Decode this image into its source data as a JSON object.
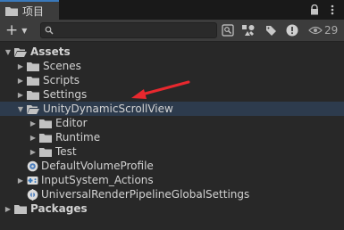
{
  "tab": {
    "label": "项目",
    "icon": "folder-icon"
  },
  "window_controls": {
    "lock_icon": "lock-icon",
    "menu_icon": "kebab-menu-icon"
  },
  "toolbar": {
    "add_label": "+",
    "search": {
      "value": "",
      "placeholder": ""
    },
    "hidden_count": "29"
  },
  "tree": [
    {
      "id": "assets",
      "label": "Assets",
      "bold": true,
      "expanded": true,
      "depth": 0,
      "icon": "folder-open-icon"
    },
    {
      "id": "scenes",
      "label": "Scenes",
      "depth": 1,
      "icon": "folder-icon"
    },
    {
      "id": "scripts",
      "label": "Scripts",
      "depth": 1,
      "icon": "folder-icon"
    },
    {
      "id": "settings",
      "label": "Settings",
      "depth": 1,
      "icon": "folder-icon"
    },
    {
      "id": "udsv",
      "label": "UnityDynamicScrollView",
      "depth": 1,
      "expanded": true,
      "selected": true,
      "icon": "folder-open-icon"
    },
    {
      "id": "editor",
      "label": "Editor",
      "depth": 2,
      "icon": "folder-icon"
    },
    {
      "id": "runtime",
      "label": "Runtime",
      "depth": 2,
      "icon": "folder-icon"
    },
    {
      "id": "test",
      "label": "Test",
      "depth": 2,
      "icon": "folder-icon"
    },
    {
      "id": "dvp",
      "label": "DefaultVolumeProfile",
      "depth": 1,
      "icon": "volume-profile-icon",
      "no_arrow": true
    },
    {
      "id": "isa",
      "label": "InputSystem_Actions",
      "depth": 1,
      "icon": "input-actions-icon"
    },
    {
      "id": "urp",
      "label": "UniversalRenderPipelineGlobalSettings",
      "depth": 1,
      "icon": "render-pipeline-settings-icon",
      "no_arrow": true
    },
    {
      "id": "packages",
      "label": "Packages",
      "bold": true,
      "depth": 0,
      "icon": "folder-icon"
    }
  ],
  "annotation": {
    "icon": "red-arrow-icon",
    "color": "#e8282e"
  },
  "colors": {
    "selection": "#2d3b4d",
    "folder": "#c2c2c2",
    "accent": "#3a79bb"
  }
}
